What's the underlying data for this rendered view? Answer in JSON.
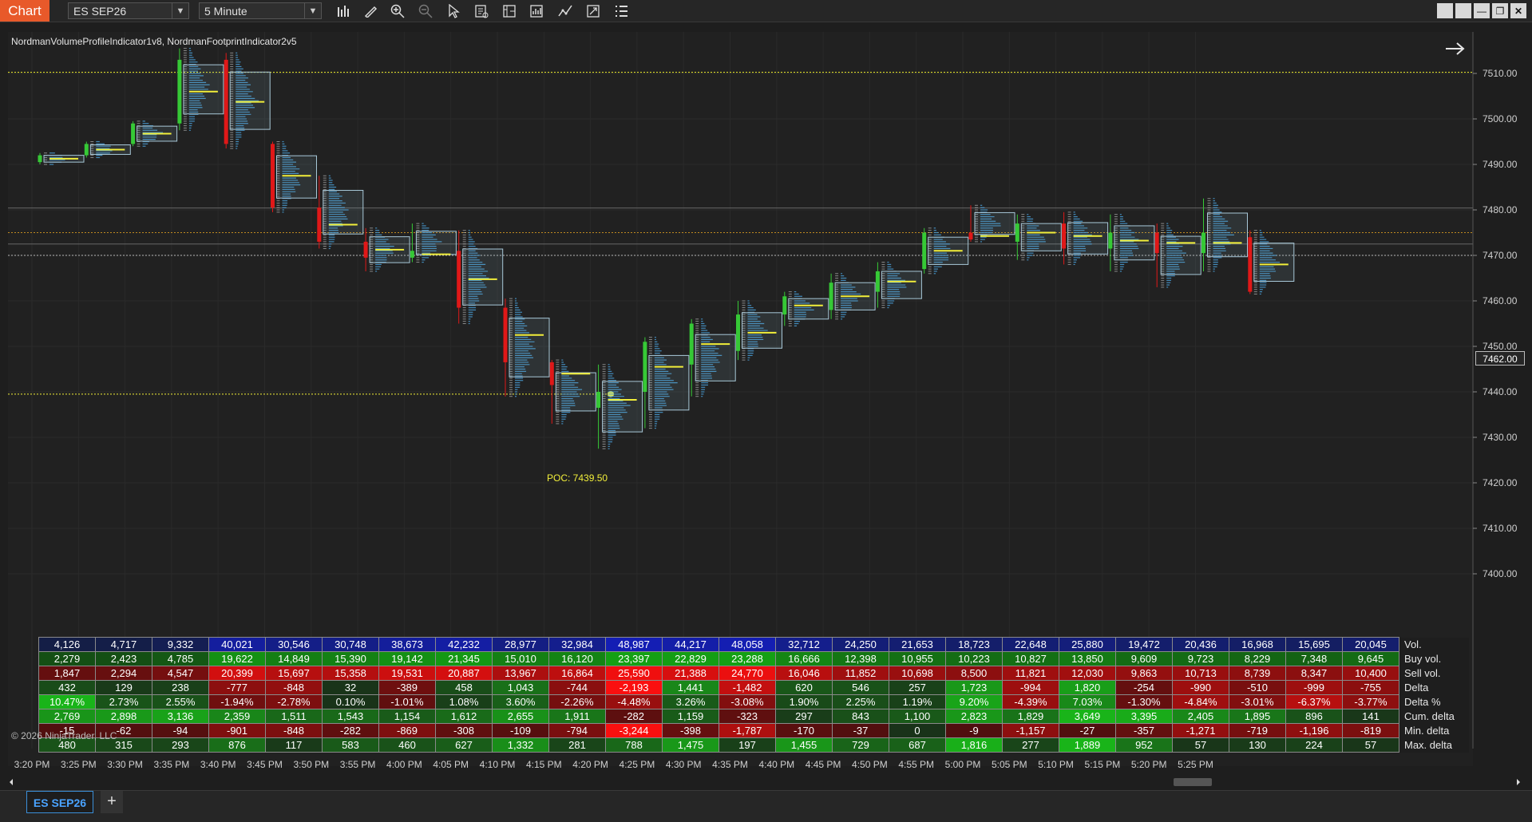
{
  "toolbar": {
    "title": "Chart",
    "instrument": "ES SEP26",
    "interval": "5 Minute",
    "tools": [
      "bar-chart-icon",
      "pencil-icon",
      "zoom-in-icon",
      "zoom-out-icon",
      "pointer-icon",
      "data-box-icon",
      "properties-icon",
      "strategies-icon",
      "indicators-icon",
      "attach-icon",
      "list-icon"
    ]
  },
  "chart": {
    "indicator_label": "NordmanVolumeProfileIndicator1v8, NordmanFootprintIndicator2v5",
    "poc_label": "POC: 7439.50",
    "current_price": "7462.00",
    "price_ticks": [
      "7510.00",
      "7500.00",
      "7490.00",
      "7480.00",
      "7470.00",
      "7460.00",
      "7450.00",
      "7440.00",
      "7430.00",
      "7420.00",
      "7410.00",
      "7400.00"
    ],
    "time_ticks": [
      "3:20 PM",
      "3:25 PM",
      "3:30 PM",
      "3:35 PM",
      "3:40 PM",
      "3:45 PM",
      "3:50 PM",
      "3:55 PM",
      "4:00 PM",
      "4:05 PM",
      "4:10 PM",
      "4:15 PM",
      "4:20 PM",
      "4:25 PM",
      "4:30 PM",
      "4:35 PM",
      "4:40 PM",
      "4:45 PM",
      "4:50 PM",
      "4:55 PM",
      "5:00 PM",
      "5:05 PM",
      "5:10 PM",
      "5:15 PM",
      "5:20 PM",
      "5:25 PM"
    ],
    "copyright": "© 2026 NinjaTrader, LLC",
    "colors": {
      "up": "#36c936",
      "down": "#e01818",
      "poc": "#f2ef3a",
      "profile": "#4a9fd8",
      "box": "#a8c8d8"
    }
  },
  "chart_data": {
    "type": "candlestick",
    "instrument": "ES SEP26",
    "interval": "5 Minute",
    "ylim": [
      7396,
      7516
    ],
    "candles": [
      {
        "time": "3:20 PM",
        "open": 7490.5,
        "high": 7492.5,
        "low": 7490.0,
        "close": 7492.0
      },
      {
        "time": "3:25 PM",
        "open": 7492.0,
        "high": 7495.0,
        "low": 7491.5,
        "close": 7494.5
      },
      {
        "time": "3:30 PM",
        "open": 7494.5,
        "high": 7499.5,
        "low": 7494.0,
        "close": 7499.0
      },
      {
        "time": "3:35 PM",
        "open": 7499.0,
        "high": 7515.5,
        "low": 7497.5,
        "close": 7513.0
      },
      {
        "time": "3:40 PM",
        "open": 7513.0,
        "high": 7514.5,
        "low": 7493.5,
        "close": 7494.5
      },
      {
        "time": "3:45 PM",
        "open": 7494.5,
        "high": 7495.0,
        "low": 7479.5,
        "close": 7480.5
      },
      {
        "time": "3:50 PM",
        "open": 7480.5,
        "high": 7487.5,
        "low": 7471.5,
        "close": 7473.0
      },
      {
        "time": "3:55 PM",
        "open": 7473.0,
        "high": 7476.0,
        "low": 7466.5,
        "close": 7469.5
      },
      {
        "time": "4:00 PM",
        "open": 7469.5,
        "high": 7477.0,
        "low": 7468.5,
        "close": 7471.0
      },
      {
        "time": "4:05 PM",
        "open": 7471.0,
        "high": 7475.5,
        "low": 7455.0,
        "close": 7458.5
      },
      {
        "time": "4:10 PM",
        "open": 7458.5,
        "high": 7460.5,
        "low": 7439.0,
        "close": 7446.5
      },
      {
        "time": "4:15 PM",
        "open": 7446.5,
        "high": 7447.0,
        "low": 7433.0,
        "close": 7441.5
      },
      {
        "time": "4:20 PM",
        "open": 7436.5,
        "high": 7446.0,
        "low": 7427.5,
        "close": 7440.0
      },
      {
        "time": "4:25 PM",
        "open": 7440.0,
        "high": 7452.0,
        "low": 7432.0,
        "close": 7451.0
      },
      {
        "time": "4:30 PM",
        "open": 7446.0,
        "high": 7456.0,
        "low": 7439.0,
        "close": 7455.0
      },
      {
        "time": "4:35 PM",
        "open": 7449.0,
        "high": 7460.0,
        "low": 7447.0,
        "close": 7457.0
      },
      {
        "time": "4:40 PM",
        "open": 7457.0,
        "high": 7462.0,
        "low": 7454.5,
        "close": 7461.0
      },
      {
        "time": "4:45 PM",
        "open": 7458.0,
        "high": 7466.0,
        "low": 7456.0,
        "close": 7464.0
      },
      {
        "time": "4:50 PM",
        "open": 7462.0,
        "high": 7468.5,
        "low": 7458.5,
        "close": 7466.5
      },
      {
        "time": "4:55 PM",
        "open": 7467.0,
        "high": 7476.0,
        "low": 7466.0,
        "close": 7475.0
      },
      {
        "time": "5:00 PM",
        "open": 7475.0,
        "high": 7481.0,
        "low": 7473.0,
        "close": 7473.5
      },
      {
        "time": "5:05 PM",
        "open": 7473.0,
        "high": 7479.0,
        "low": 7469.0,
        "close": 7477.0
      },
      {
        "time": "5:10 PM",
        "open": 7477.0,
        "high": 7479.5,
        "low": 7468.0,
        "close": 7471.5
      },
      {
        "time": "5:15 PM",
        "open": 7471.5,
        "high": 7479.0,
        "low": 7466.5,
        "close": 7475.0
      },
      {
        "time": "5:20 PM",
        "open": 7475.0,
        "high": 7477.0,
        "low": 7463.0,
        "close": 7470.5
      },
      {
        "time": "5:25 PM",
        "open": 7470.5,
        "high": 7482.5,
        "low": 7466.5,
        "close": 7475.0
      },
      {
        "time": "5:30 PM",
        "open": 7474.0,
        "high": 7475.5,
        "low": 7461.5,
        "close": 7462.0
      }
    ],
    "levels": [
      {
        "name": "poc",
        "price": 7439.5
      },
      {
        "name": "high-level",
        "price": 7510.25
      },
      {
        "name": "level-a",
        "price": 7475.0
      },
      {
        "name": "level-b",
        "price": 7470.0
      }
    ]
  },
  "stats": {
    "rows": [
      {
        "label": "Vol.",
        "values": [
          "4,126",
          "4,717",
          "9,332",
          "40,021",
          "30,546",
          "30,748",
          "38,673",
          "42,232",
          "28,977",
          "32,984",
          "48,987",
          "44,217",
          "48,058",
          "32,712",
          "24,250",
          "21,653",
          "18,723",
          "22,648",
          "25,880",
          "19,472",
          "20,436",
          "16,968",
          "15,695",
          "20,045"
        ]
      },
      {
        "label": "Buy vol.",
        "values": [
          "2,279",
          "2,423",
          "4,785",
          "19,622",
          "14,849",
          "15,390",
          "19,142",
          "21,345",
          "15,010",
          "16,120",
          "23,397",
          "22,829",
          "23,288",
          "16,666",
          "12,398",
          "10,955",
          "10,223",
          "10,827",
          "13,850",
          "9,609",
          "9,723",
          "8,229",
          "7,348",
          "9,645"
        ]
      },
      {
        "label": "Sell vol.",
        "values": [
          "1,847",
          "2,294",
          "4,547",
          "20,399",
          "15,697",
          "15,358",
          "19,531",
          "20,887",
          "13,967",
          "16,864",
          "25,590",
          "21,388",
          "24,770",
          "16,046",
          "11,852",
          "10,698",
          "8,500",
          "11,821",
          "12,030",
          "9,863",
          "10,713",
          "8,739",
          "8,347",
          "10,400"
        ]
      },
      {
        "label": "Delta",
        "values": [
          "432",
          "129",
          "238",
          "-777",
          "-848",
          "32",
          "-389",
          "458",
          "1,043",
          "-744",
          "-2,193",
          "1,441",
          "-1,482",
          "620",
          "546",
          "257",
          "1,723",
          "-994",
          "1,820",
          "-254",
          "-990",
          "-510",
          "-999",
          "-755"
        ]
      },
      {
        "label": "Delta %",
        "values": [
          "10.47%",
          "2.73%",
          "2.55%",
          "-1.94%",
          "-2.78%",
          "0.10%",
          "-1.01%",
          "1.08%",
          "3.60%",
          "-2.26%",
          "-4.48%",
          "3.26%",
          "-3.08%",
          "1.90%",
          "2.25%",
          "1.19%",
          "9.20%",
          "-4.39%",
          "7.03%",
          "-1.30%",
          "-4.84%",
          "-3.01%",
          "-6.37%",
          "-3.77%"
        ]
      },
      {
        "label": "Cum. delta",
        "values": [
          "2,769",
          "2,898",
          "3,136",
          "2,359",
          "1,511",
          "1,543",
          "1,154",
          "1,612",
          "2,655",
          "1,911",
          "-282",
          "1,159",
          "-323",
          "297",
          "843",
          "1,100",
          "2,823",
          "1,829",
          "3,649",
          "3,395",
          "2,405",
          "1,895",
          "896",
          "141"
        ]
      },
      {
        "label": "Min. delta",
        "values": [
          "-15",
          "-62",
          "-94",
          "-901",
          "-848",
          "-282",
          "-869",
          "-308",
          "-109",
          "-794",
          "-3,244",
          "-398",
          "-1,787",
          "-170",
          "-37",
          "0",
          "-9",
          "-1,157",
          "-27",
          "-357",
          "-1,271",
          "-719",
          "-1,196",
          "-819"
        ]
      },
      {
        "label": "Max. delta",
        "values": [
          "480",
          "315",
          "293",
          "876",
          "117",
          "583",
          "460",
          "627",
          "1,332",
          "281",
          "788",
          "1,475",
          "197",
          "1,455",
          "729",
          "687",
          "1,816",
          "277",
          "1,889",
          "952",
          "57",
          "130",
          "224",
          "57"
        ]
      }
    ]
  },
  "bottom": {
    "instrument_tab": "ES SEP26",
    "add_tab": "+"
  }
}
